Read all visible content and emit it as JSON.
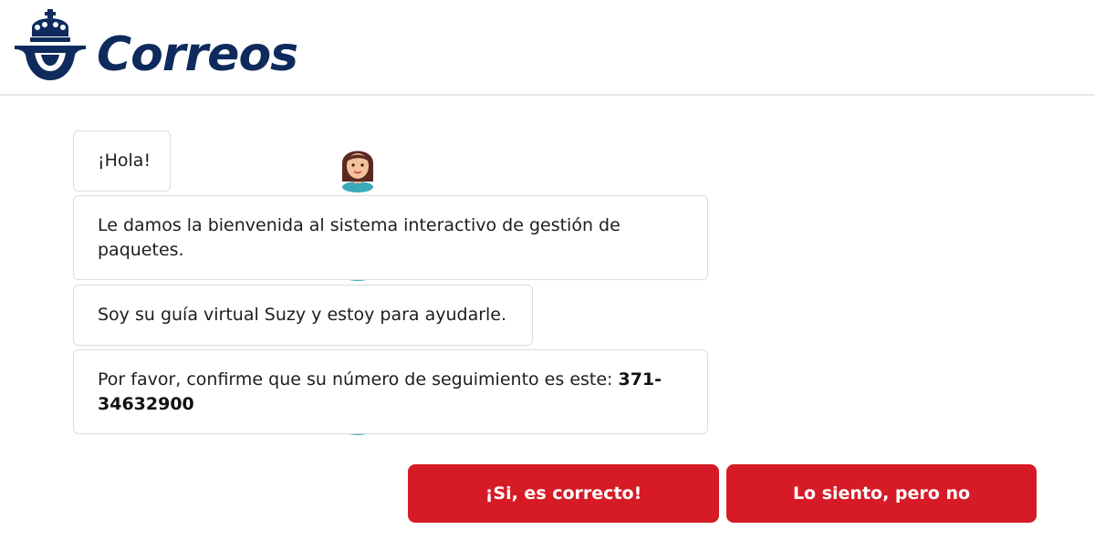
{
  "brand": {
    "name": "Correos",
    "color": "#0f2a5c",
    "emblem_icon": "crown-posthorn-icon"
  },
  "colors": {
    "accent": "#d61b27",
    "bubble_border": "#dcdcdc"
  },
  "messages": [
    {
      "text": "¡Hola!"
    },
    {
      "text": "Le damos la bienvenida al sistema interactivo de gestión de paquetes."
    },
    {
      "text": "Soy su guía virtual Suzy y estoy para ayudarle."
    },
    {
      "text_prefix": "Por favor, confirme que su número de seguimiento es este: ",
      "tracking_number": "371-34632900"
    }
  ],
  "actions": {
    "confirm_label": "¡Si, es correcto!",
    "deny_label": "Lo siento, pero no"
  }
}
